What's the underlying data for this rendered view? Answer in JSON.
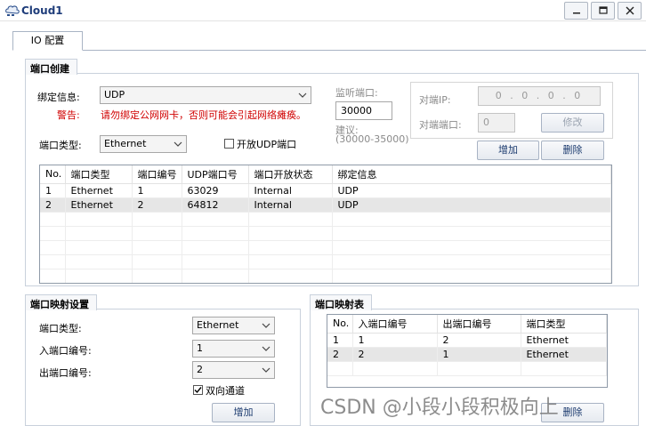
{
  "window": {
    "title": "Cloud1"
  },
  "tabs": [
    {
      "label": "IO 配置"
    }
  ],
  "port_create": {
    "section_title": "端口创建",
    "bind_label": "绑定信息:",
    "bind_value": "UDP",
    "warning_label": "警告:",
    "warning_text": "请勿绑定公网网卡，否则可能会引起网络瘫痪。",
    "port_type_label": "端口类型:",
    "port_type_value": "Ethernet",
    "open_udp_label": "开放UDP端口",
    "listen_port_label": "监听端口:",
    "listen_port_value": "30000",
    "suggest_label": "建议:",
    "suggest_range": "(30000-35000)",
    "peer_ip_label": "对端IP:",
    "peer_ip_value": "0 . 0 . 0 . 0",
    "peer_port_label": "对端端口:",
    "peer_port_value": "0",
    "modify_button": "修改",
    "add_button": "增加",
    "delete_button": "删除"
  },
  "port_table": {
    "columns": [
      "No.",
      "端口类型",
      "端口编号",
      "UDP端口号",
      "端口开放状态",
      "绑定信息"
    ],
    "rows": [
      [
        "1",
        "Ethernet",
        "1",
        "63029",
        "Internal",
        "UDP"
      ],
      [
        "2",
        "Ethernet",
        "2",
        "64812",
        "Internal",
        "UDP"
      ]
    ]
  },
  "port_mapping_settings": {
    "section_title": "端口映射设置",
    "port_type_label": "端口类型:",
    "port_type_value": "Ethernet",
    "in_port_label": "入端口编号:",
    "in_port_value": "1",
    "out_port_label": "出端口编号:",
    "out_port_value": "2",
    "bidirectional_label": "双向通道",
    "add_button": "增加"
  },
  "port_mapping_table": {
    "section_title": "端口映射表",
    "columns": [
      "No.",
      "入端口编号",
      "出端口编号",
      "端口类型"
    ],
    "rows": [
      [
        "1",
        "1",
        "2",
        "Ethernet"
      ],
      [
        "2",
        "2",
        "1",
        "Ethernet"
      ]
    ],
    "delete_button": "删除"
  },
  "watermark": "CSDN @小段小段积极向上"
}
